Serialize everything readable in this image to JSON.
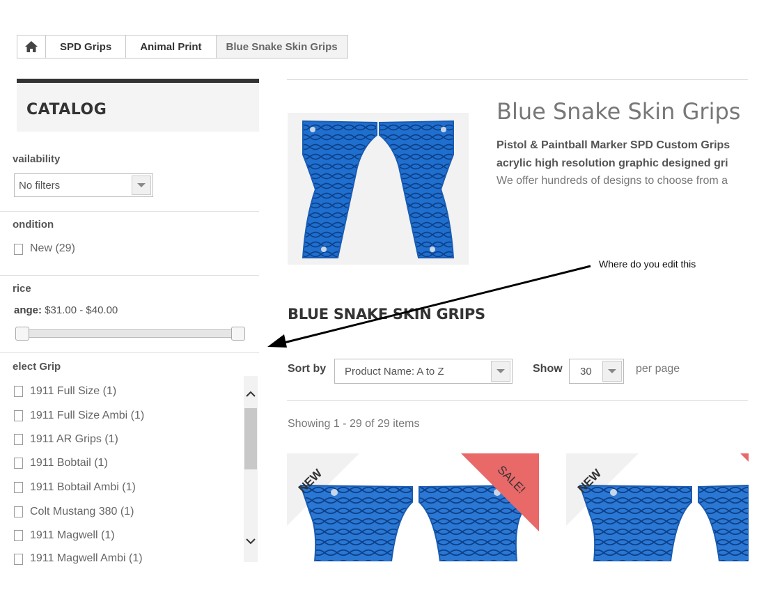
{
  "breadcrumb": {
    "home_icon": "home-icon",
    "items": [
      "SPD Grips",
      "Animal Print",
      "Blue Snake Skin Grips"
    ]
  },
  "sidebar": {
    "title": "CATALOG",
    "availability": {
      "title": "vailability",
      "select_value": "No filters"
    },
    "condition": {
      "title": "ondition",
      "options": [
        "New (29)"
      ]
    },
    "price": {
      "title": "rice",
      "range_label": "ange:",
      "range_value": "$31.00 - $40.00",
      "min_fraction": 0.0,
      "max_fraction": 1.0
    },
    "grip": {
      "title": "elect Grip",
      "options": [
        "1911 Full Size (1)",
        "1911 Full Size Ambi (1)",
        "1911 AR Grips (1)",
        "1911 Bobtail (1)",
        "1911 Bobtail Ambi (1)",
        "Colt Mustang 380 (1)",
        "1911 Magwell (1)",
        "1911 Magwell Ambi (1)"
      ]
    }
  },
  "category": {
    "heading": "Blue Snake Skin Grips",
    "desc_line1": "Pistol & Paintball Marker SPD Custom Grips",
    "desc_line2": "acrylic high resolution graphic designed gri",
    "desc_line3": "We offer hundreds of designs to choose from a",
    "section_title": "BLUE SNAKE SKIN GRIPS"
  },
  "toolbar": {
    "sort_label": "Sort by",
    "sort_value": "Product Name: A to Z",
    "show_label": "Show",
    "show_value": "30",
    "per_page_label": "per page",
    "showing": "Showing 1 - 29 of 29 items"
  },
  "products": [
    {
      "badge": "NEW",
      "sale": "SALE!"
    },
    {
      "badge": "NEW",
      "sale": ""
    }
  ],
  "annotation": {
    "text": "Where do you edit this"
  },
  "colors": {
    "grip_blue": "#1f6fcf",
    "sale_red": "#e85c5c"
  }
}
